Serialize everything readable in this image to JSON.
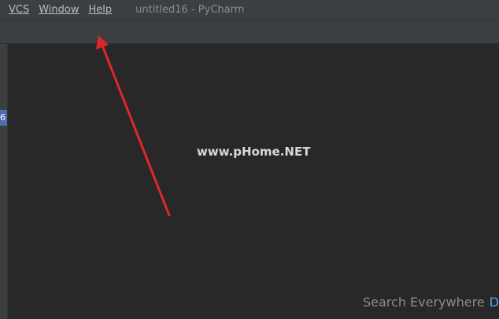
{
  "menubar": {
    "items": [
      {
        "label": "VCS"
      },
      {
        "label": "Window"
      },
      {
        "label": "Help"
      }
    ],
    "window_title": "untitled16 - PyCharm"
  },
  "left_strip": {
    "marker_text": "",
    "tab_label": "6"
  },
  "editor": {
    "watermark": "www.pHome.NET",
    "search_hint": "Search Everywhere",
    "search_hint_accent": "Do"
  },
  "colors": {
    "arrow": "#e0262b",
    "accent": "#589df6",
    "tab_selected": "#4b6eaf"
  }
}
